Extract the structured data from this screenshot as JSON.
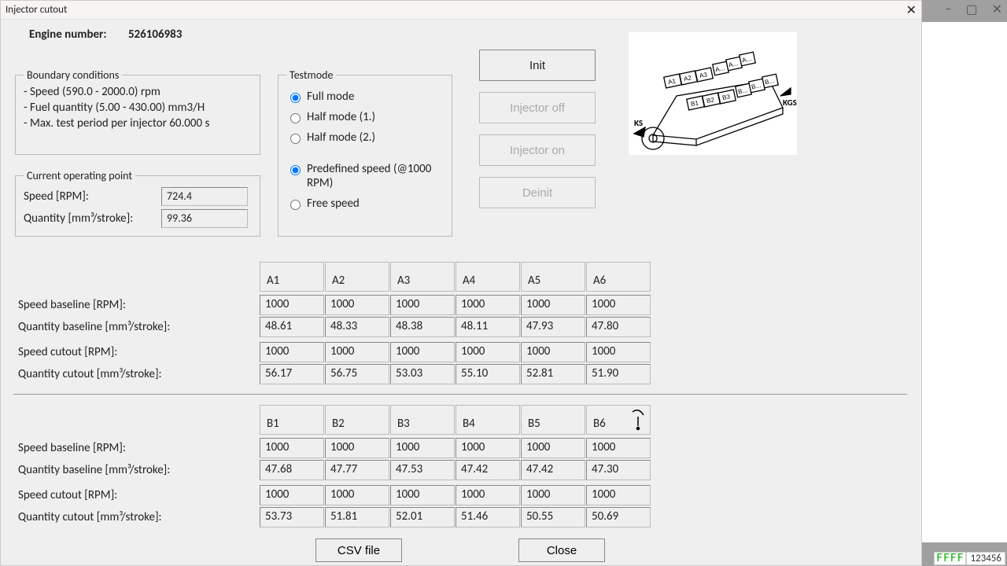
{
  "bg_window": {
    "minimize": "–",
    "maximize": "▢",
    "close": "✕"
  },
  "window": {
    "title": "Injector cutout",
    "close": "✕"
  },
  "engine": {
    "label": "Engine number:",
    "value": "526106983"
  },
  "boundary": {
    "legend": "Boundary conditions",
    "l1": "- Speed (590.0 - 2000.0) rpm",
    "l2": "- Fuel quantity (5.00 - 430.00) mm3/H",
    "l3": "- Max. test period per injector 60.000 s"
  },
  "cop": {
    "legend": "Current operating point",
    "speed_label": "Speed [RPM]:",
    "speed_value": "724.4",
    "qty_label": "Quantity [mm³/stroke]:",
    "qty_value": "99.36"
  },
  "testmode": {
    "legend": "Testmode",
    "opt_full": "Full mode",
    "opt_half1": "Half mode (1.)",
    "opt_half2": "Half mode (2.)",
    "opt_predef": "Predefined speed (@1000 RPM)",
    "opt_free": "Free speed"
  },
  "buttons": {
    "init": "Init",
    "inj_off": "Injector off",
    "inj_on": "Injector on",
    "deinit": "Deinit",
    "csv": "CSV file",
    "close": "Close"
  },
  "diagram": {
    "kgs": "KGS",
    "ks": "KS",
    "a_labels": [
      "A1",
      "A2",
      "A3",
      "A...",
      "A...",
      "A..."
    ],
    "b_labels": [
      "B1",
      "B2",
      "B3",
      "B...",
      "B...",
      "B..."
    ]
  },
  "rows": {
    "speed_baseline": "Speed baseline [RPM]:",
    "qty_baseline": "Quantity baseline [mm³/stroke]:",
    "speed_cutout_a": "Speed cutout  [RPM]:",
    "qty_cutout_a": "Quantity cutout  [mm³/stroke]:",
    "speed_cutout_b": "Speed cutout [RPM]:",
    "qty_cutout_b": "Quantity cutout [mm³/stroke]:"
  },
  "bankA": {
    "headers": [
      "A1",
      "A2",
      "A3",
      "A4",
      "A5",
      "A6"
    ],
    "speed_baseline": [
      "1000",
      "1000",
      "1000",
      "1000",
      "1000",
      "1000"
    ],
    "qty_baseline": [
      "48.61",
      "48.33",
      "48.38",
      "48.11",
      "47.93",
      "47.80"
    ],
    "speed_cutout": [
      "1000",
      "1000",
      "1000",
      "1000",
      "1000",
      "1000"
    ],
    "qty_cutout": [
      "56.17",
      "56.75",
      "53.03",
      "55.10",
      "52.81",
      "51.90"
    ]
  },
  "bankB": {
    "headers": [
      "B1",
      "B2",
      "B3",
      "B4",
      "B5",
      "B6"
    ],
    "speed_baseline": [
      "1000",
      "1000",
      "1000",
      "1000",
      "1000",
      "1000"
    ],
    "qty_baseline": [
      "47.68",
      "47.77",
      "47.53",
      "47.42",
      "47.42",
      "47.30"
    ],
    "speed_cutout": [
      "1000",
      "1000",
      "1000",
      "1000",
      "1000",
      "1000"
    ],
    "qty_cutout": [
      "53.73",
      "51.81",
      "52.01",
      "51.46",
      "50.55",
      "50.69"
    ]
  },
  "status": {
    "green": "FFFF",
    "num": "123456"
  }
}
